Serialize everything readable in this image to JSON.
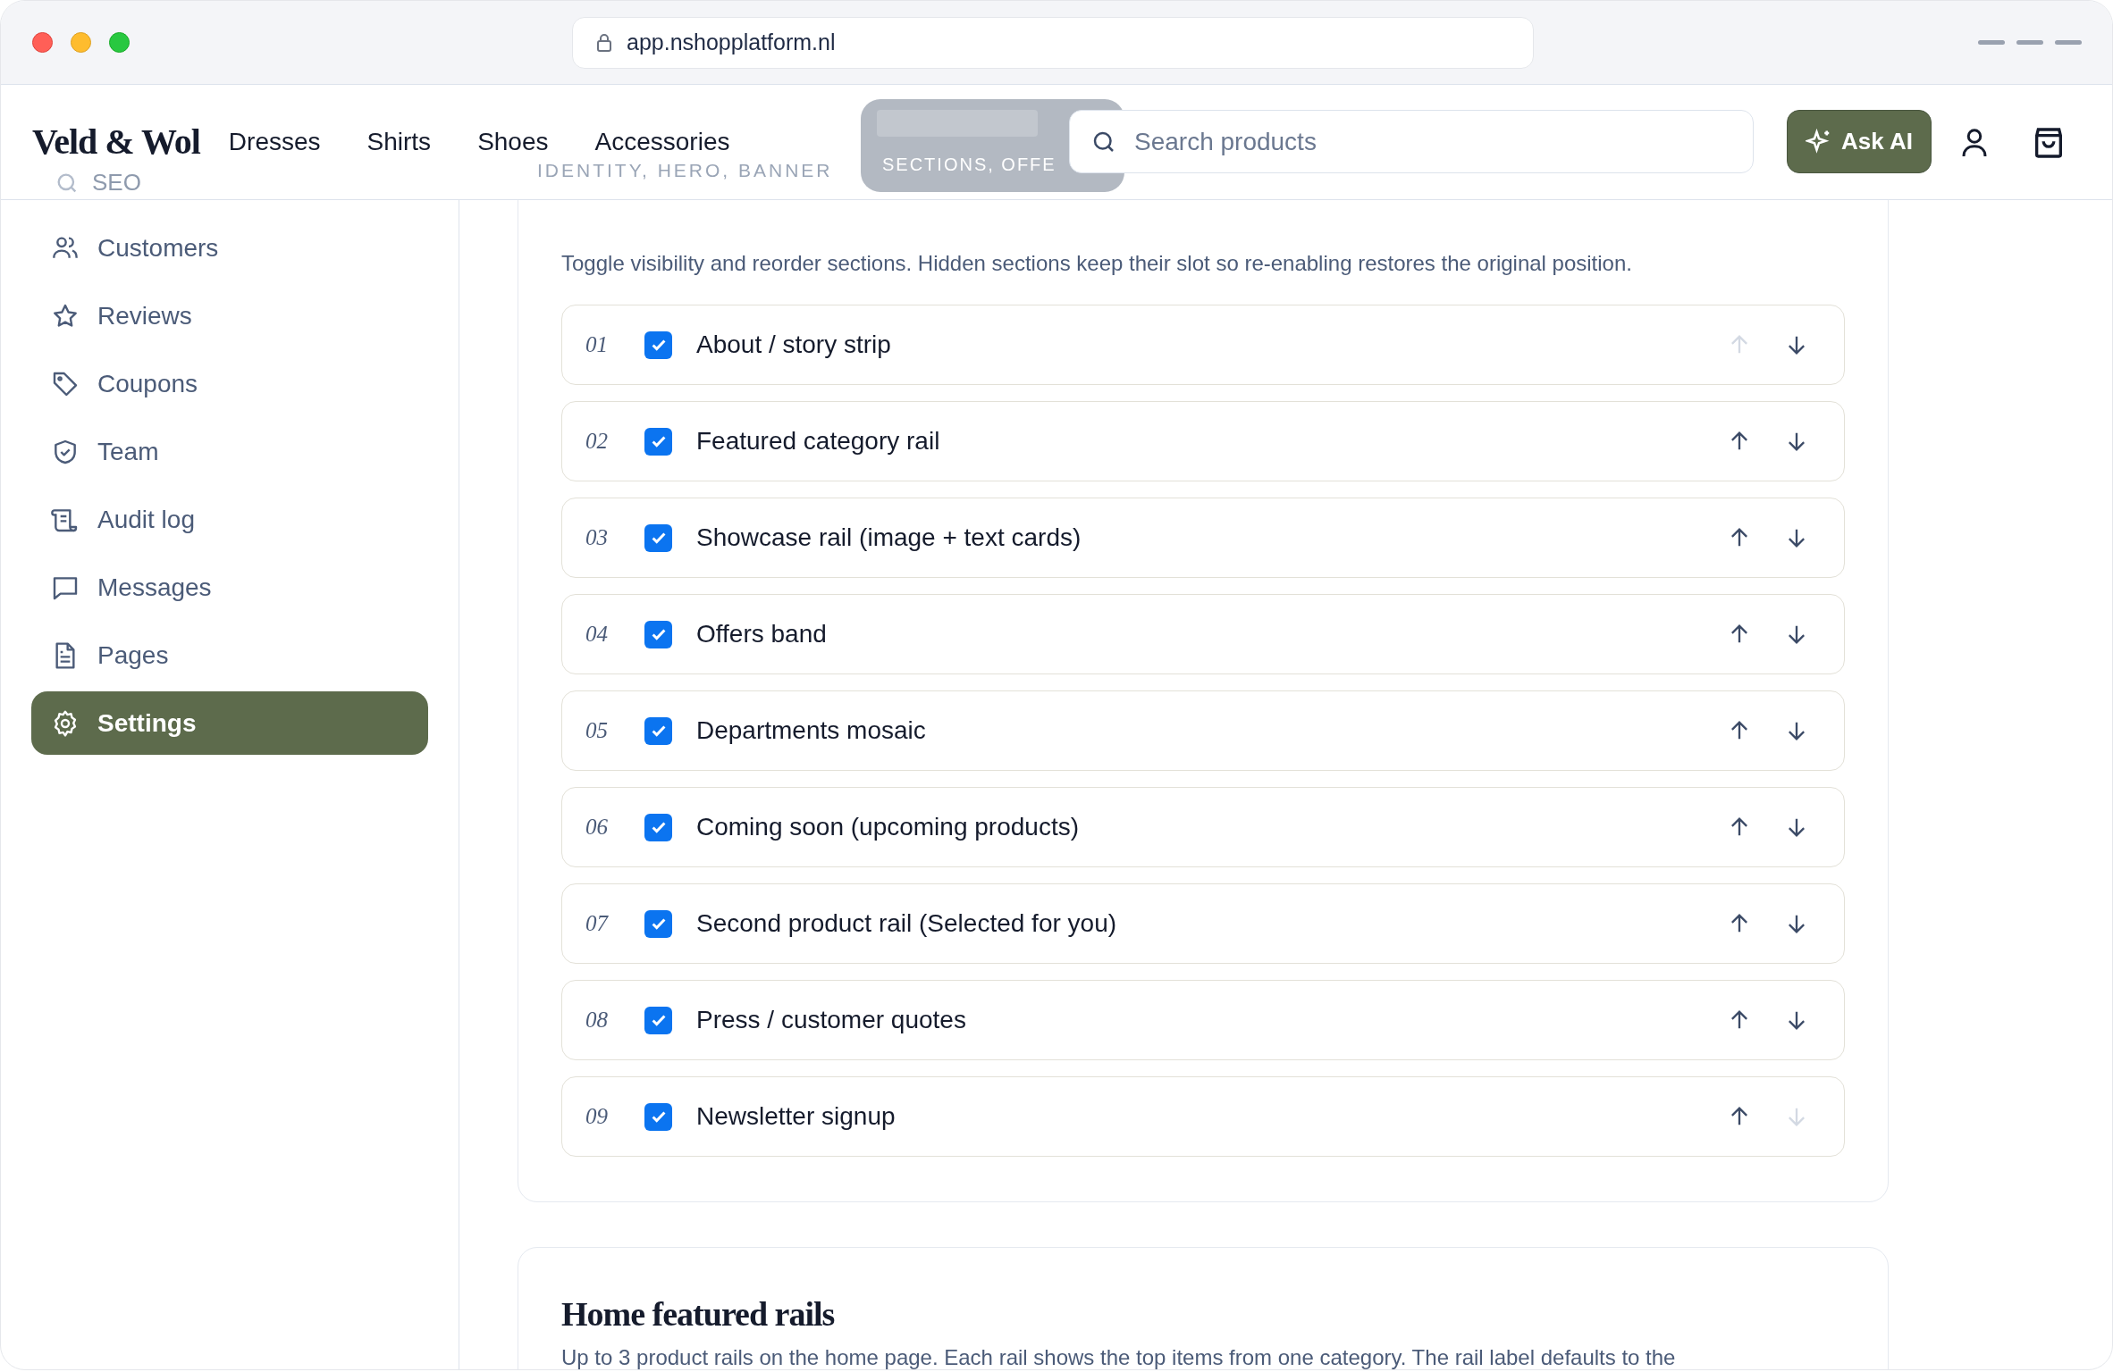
{
  "browser": {
    "url": "app.nshopplatform.nl"
  },
  "header": {
    "logo": "Veld & Wol",
    "nav": [
      "Dresses",
      "Shirts",
      "Shoes",
      "Accessories"
    ],
    "search": {
      "placeholder": "Search products"
    },
    "ask_button": "Ask AI"
  },
  "ghost_behind_header": {
    "sidebar_item": "SEO",
    "tab_1": "IDENTITY, HERO, BANNER",
    "tab_2": "SECTIONS, OFFE"
  },
  "sidebar": {
    "items": [
      {
        "label": "Customers",
        "selected": false
      },
      {
        "label": "Reviews",
        "selected": false
      },
      {
        "label": "Coupons",
        "selected": false
      },
      {
        "label": "Team",
        "selected": false
      },
      {
        "label": "Audit log",
        "selected": false
      },
      {
        "label": "Messages",
        "selected": false
      },
      {
        "label": "Pages",
        "selected": false
      },
      {
        "label": "Settings",
        "selected": true
      }
    ]
  },
  "sections_card": {
    "description": "Toggle visibility and reorder sections. Hidden sections keep their slot so re-enabling restores the original position.",
    "sections": [
      {
        "number": "01",
        "label": "About / story strip",
        "checked": true,
        "can_move_up": false,
        "can_move_down": true
      },
      {
        "number": "02",
        "label": "Featured category rail",
        "checked": true,
        "can_move_up": true,
        "can_move_down": true
      },
      {
        "number": "03",
        "label": "Showcase rail (image + text cards)",
        "checked": true,
        "can_move_up": true,
        "can_move_down": true
      },
      {
        "number": "04",
        "label": "Offers band",
        "checked": true,
        "can_move_up": true,
        "can_move_down": true
      },
      {
        "number": "05",
        "label": "Departments mosaic",
        "checked": true,
        "can_move_up": true,
        "can_move_down": true
      },
      {
        "number": "06",
        "label": "Coming soon (upcoming products)",
        "checked": true,
        "can_move_up": true,
        "can_move_down": true
      },
      {
        "number": "07",
        "label": "Second product rail (Selected for you)",
        "checked": true,
        "can_move_up": true,
        "can_move_down": true
      },
      {
        "number": "08",
        "label": "Press / customer quotes",
        "checked": true,
        "can_move_up": true,
        "can_move_down": true
      },
      {
        "number": "09",
        "label": "Newsletter signup",
        "checked": true,
        "can_move_up": true,
        "can_move_down": false
      }
    ]
  },
  "featured_rails_card": {
    "title": "Home featured rails",
    "description": "Up to 3 product rails on the home page. Each rail shows the top items from one category. The rail label defaults to the"
  }
}
